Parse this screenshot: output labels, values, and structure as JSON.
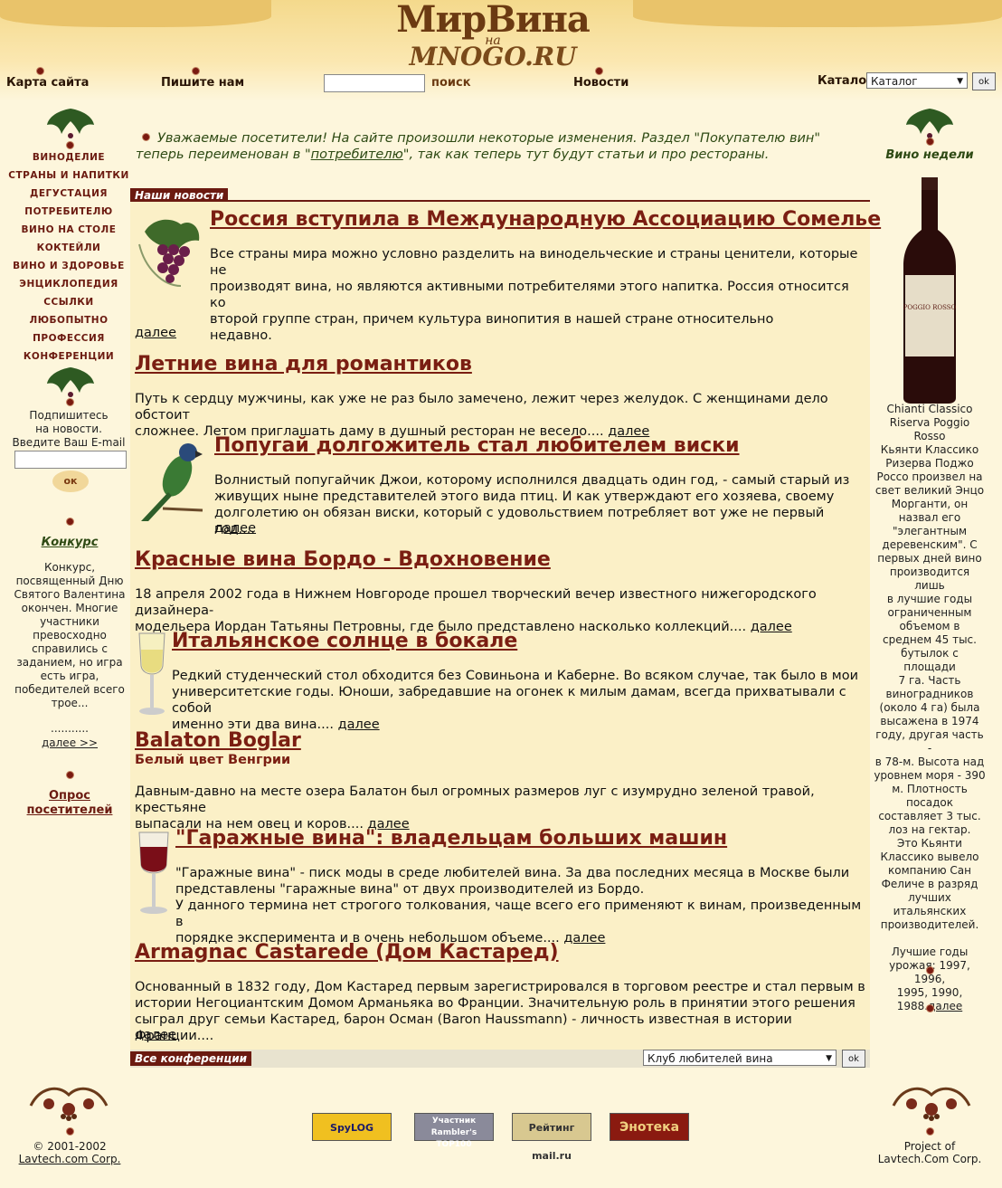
{
  "logo": {
    "line1": "МирВина",
    "line2": "на",
    "line3": "MNOGO.RU"
  },
  "topnav": {
    "sitemap": "Карта сайта",
    "write": "Пишите нам",
    "search_btn": "поиск",
    "news": "Новости",
    "catalog_label": "Каталог",
    "catalog_value": "Каталог",
    "ok": "ok"
  },
  "leftnav": {
    "items": [
      "ВИНОДЕЛИЕ",
      "СТРАНЫ И НАПИТКИ",
      "ДЕГУСТАЦИЯ",
      "ПОТРЕБИТЕЛЮ",
      "ВИНО НА СТОЛЕ",
      "КОКТЕЙЛИ",
      "ВИНО И ЗДОРОВЬЕ",
      "ЭНЦИКЛОПЕДИЯ",
      "ССЫЛКИ",
      "ЛЮБОПЫТНО",
      "ПРОФЕССИЯ",
      "КОНФЕРЕНЦИИ"
    ]
  },
  "subscribe": {
    "line1": "Подпишитесь",
    "line2": "на новости.",
    "line3": "Введите Ваш E-mail",
    "ok": "ок"
  },
  "contest": {
    "title": "Конкурс",
    "text": [
      "Конкурс,",
      "посвященный Дню",
      "Святого Валентина",
      "окончен. Многие",
      "участники",
      "превосходно",
      "справились с",
      "заданием, но игра",
      "есть игра,",
      "победителей всего",
      "трое..."
    ],
    "dots": "...........",
    "more": "далее >>"
  },
  "poll": {
    "line1": "Опрос",
    "line2": "посетителей"
  },
  "intro": {
    "part1": "Уважаемые посетители! На сайте произошли некоторые изменения. Раздел \"Покупателю вин\" теперь переименован в \"",
    "link": "потребителю",
    "part2": "\", так как теперь тут будут статьи и про рестораны."
  },
  "news_header": "Наши новости",
  "more_label": "далее",
  "articles": [
    {
      "title": "Россия вступила в Международную Ассоциацию Сомелье",
      "lines": [
        "Все страны мира можно условно разделить на винодельческие и страны ценители, которые не",
        "производят вина, но являются активными потребителями этого напитка. Россия относится ко",
        "второй группе стран, причем культура винопития в нашей стране относительно",
        "недавно."
      ]
    },
    {
      "title": "Летние вина для романтиков",
      "lines": [
        "Путь к сердцу мужчины, как уже не раз было замечено, лежит через желудок. С женщинами дело обстоит",
        "сложнее. Летом приглашать даму в душный ресторан не весело...."
      ]
    },
    {
      "title": "Попугай долгожитель стал любителем виски",
      "lines": [
        "Волнистый попугайчик Джои, которому исполнился двадцать один год, - самый старый из",
        "живущих ныне представителей этого вида птиц. И как утверждают его хозяева, своему",
        "долголетию он обязан виски, который с удовольствием потребляет вот уже не первый год...."
      ]
    },
    {
      "title": "Красные вина Бордо - Вдохновение",
      "lines": [
        "18 апреля 2002 года в Нижнем Новгороде прошел творческий вечер известного нижегородского дизайнера-",
        "модельера Иордан Татьяны Петровны, где было представлено насколько коллекций...."
      ]
    },
    {
      "title": "Итальянское солнце в бокале",
      "lines": [
        "Редкий студенческий стол обходится без Совиньона и Каберне. Во всяком случае, так было в мои",
        "университетские годы. Юноши, забредавшие на огонек к милым дамам, всегда прихватывали с собой",
        "именно эти два вина...."
      ]
    },
    {
      "title": "Balaton Boglar",
      "subtitle": "Белый цвет Венгрии",
      "lines": [
        "Давным-давно на месте озера Балатон был огромных размеров луг с изумрудно зеленой травой, крестьяне",
        "выпасали на нем овец и коров...."
      ]
    },
    {
      "title": "\"Гаражные вина\": владельцам больших машин",
      "lines": [
        "\"Гаражные вина\" - писк моды в среде любителей вина. За два последних месяца в Москве были",
        "представлены \"гаражные вина\" от двух производителей из Бордо.",
        "У данного термина нет строгого толкования, чаще всего его применяют к винам, произведенным в",
        "порядке эксперимента и в очень небольшом объеме...."
      ]
    },
    {
      "title": "Armagnac Castarede (Дом Кастаред)",
      "lines": [
        "Основанный в 1832 году, Дом Кастаред первым зарегистрировался в торговом реестре и стал первым в",
        "истории Негоциантским Домом Арманьяка во Франции. Значительную роль в принятии этого решения",
        "сыграл друг семьи Кастаред, барон Осман (Baron Haussmann) - личность известная в истории Франции...."
      ]
    }
  ],
  "conferences": {
    "label": "Все конференции",
    "select": "Клуб любителей вина",
    "ok": "ok"
  },
  "wine_week": {
    "title": "Вино недели",
    "bottle_label": "POGGIO ROSSO",
    "lines": [
      "Chianti Classico",
      "Riserva Poggio",
      "Rosso",
      "Кьянти Классико",
      "Ризерва Поджо",
      "Россо произвел на",
      "свет великий Энцо",
      "Морганти, он",
      "назвал его",
      "\"элегантным",
      "деревенским\". С",
      "первых дней вино",
      "производится лишь",
      "в лучшие годы",
      "ограниченным",
      "объемом в",
      "среднем 45 тыс.",
      "бутылок с площади",
      "7 га. Часть",
      "виноградников",
      "(около 4 га) была",
      "высажена в 1974",
      "году, другая часть -",
      "в 78-м. Высота над",
      "уровнем моря - 390",
      "м. Плотность",
      "посадок",
      "составляет 3 тыс.",
      "лоз на гектар.",
      "Это Кьянти",
      "Классико вывело",
      "компанию Сан",
      "Феличе в разряд",
      "лучших",
      "итальянских",
      "производителей."
    ],
    "best_years": [
      "Лучшие годы",
      "урожая: 1997, 1996,",
      "1995, 1990,",
      "1988."
    ],
    "more": "далее"
  },
  "footer": {
    "copyright": "© 2001-2002",
    "company": "Lavtech.com Corp.",
    "project1": "Project of",
    "project2": "Lavtech.Com Corp."
  },
  "badges": [
    "SpyLOG",
    "Участник Rambler's TOP100",
    "Рейтинг mail.ru",
    "Энотека"
  ],
  "colors": {
    "accent": "#6b1a10",
    "title": "#7a1e12",
    "background": "#fdf6dc",
    "content": "#fbf0c7",
    "green_text": "#2e4a14"
  }
}
